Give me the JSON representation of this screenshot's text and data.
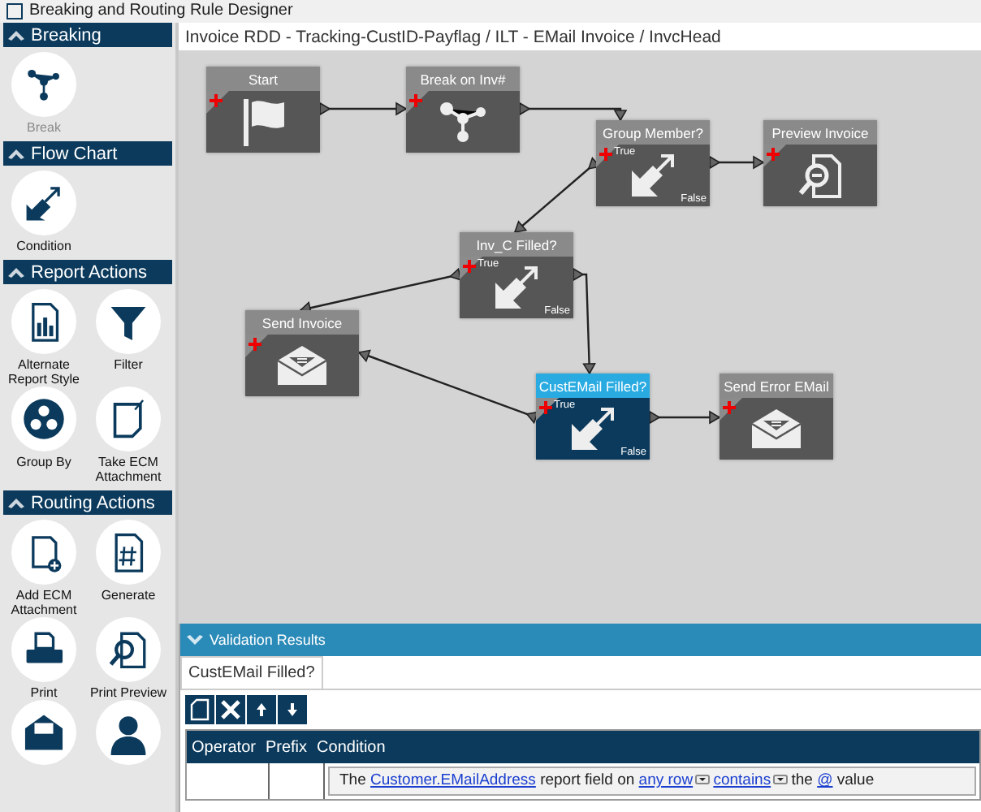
{
  "window": {
    "title": "Breaking and Routing Rule Designer"
  },
  "sidebar": {
    "sections": [
      {
        "title": "Breaking",
        "items": [
          {
            "kind": "tool",
            "label": "Break",
            "disabled": true
          }
        ]
      },
      {
        "title": "Flow Chart",
        "items": [
          {
            "kind": "tool",
            "label": "Condition",
            "disabled": false
          }
        ]
      },
      {
        "title": "Report Actions",
        "items": [
          {
            "kind": "tool",
            "label": "Alternate Report Style",
            "disabled": false
          },
          {
            "kind": "tool",
            "label": "Filter",
            "disabled": false
          },
          {
            "kind": "tool",
            "label": "Group By",
            "disabled": false
          },
          {
            "kind": "tool",
            "label": "Take ECM Attachment",
            "disabled": false
          }
        ]
      },
      {
        "title": "Routing Actions",
        "items": [
          {
            "kind": "tool",
            "label": "Add ECM Attachment",
            "disabled": false
          },
          {
            "kind": "tool",
            "label": "Generate",
            "disabled": false
          },
          {
            "kind": "tool",
            "label": "Print",
            "disabled": false
          },
          {
            "kind": "tool",
            "label": "Print Preview",
            "disabled": false
          },
          {
            "kind": "cut-off"
          },
          {
            "kind": "cut-off"
          }
        ]
      }
    ]
  },
  "breadcrumb": "Invoice RDD - Tracking-CustID-Payflag / ILT - EMail Invoice / InvcHead",
  "canvas": {
    "nodes": [
      {
        "title": "Start",
        "kind": "start",
        "selected": false
      },
      {
        "title": "Break on Inv#",
        "kind": "break",
        "selected": false
      },
      {
        "title": "Group Member?",
        "kind": "condition",
        "selected": false,
        "true_label": "True",
        "false_label": "False"
      },
      {
        "title": "Preview Invoice",
        "kind": "preview",
        "selected": false
      },
      {
        "title": "Inv_C Filled?",
        "kind": "condition",
        "selected": false,
        "true_label": "True",
        "false_label": "False"
      },
      {
        "title": "Send Invoice",
        "kind": "email",
        "selected": false
      },
      {
        "title": "CustEMail Filled?",
        "kind": "condition",
        "selected": true,
        "true_label": "True",
        "false_label": "False"
      },
      {
        "title": "Send Error EMail",
        "kind": "email",
        "selected": false
      }
    ]
  },
  "validation": {
    "title": "Validation Results",
    "tabs": [
      {
        "label": "CustEMail Filled?",
        "selected": true
      }
    ],
    "table": {
      "columns": [
        "Operator",
        "Prefix",
        "Condition"
      ],
      "rows": [
        {
          "condition": [
            {
              "kind": "text",
              "text": "The"
            },
            {
              "kind": "link",
              "text": "Customer.EMailAddress"
            },
            {
              "kind": "text",
              "text": "report field on"
            },
            {
              "kind": "dropdown",
              "text": "any row"
            },
            {
              "kind": "dropdown",
              "text": "contains"
            },
            {
              "kind": "text",
              "text": "the"
            },
            {
              "kind": "link",
              "text": "@"
            },
            {
              "kind": "text",
              "text": "value"
            }
          ]
        }
      ]
    }
  }
}
